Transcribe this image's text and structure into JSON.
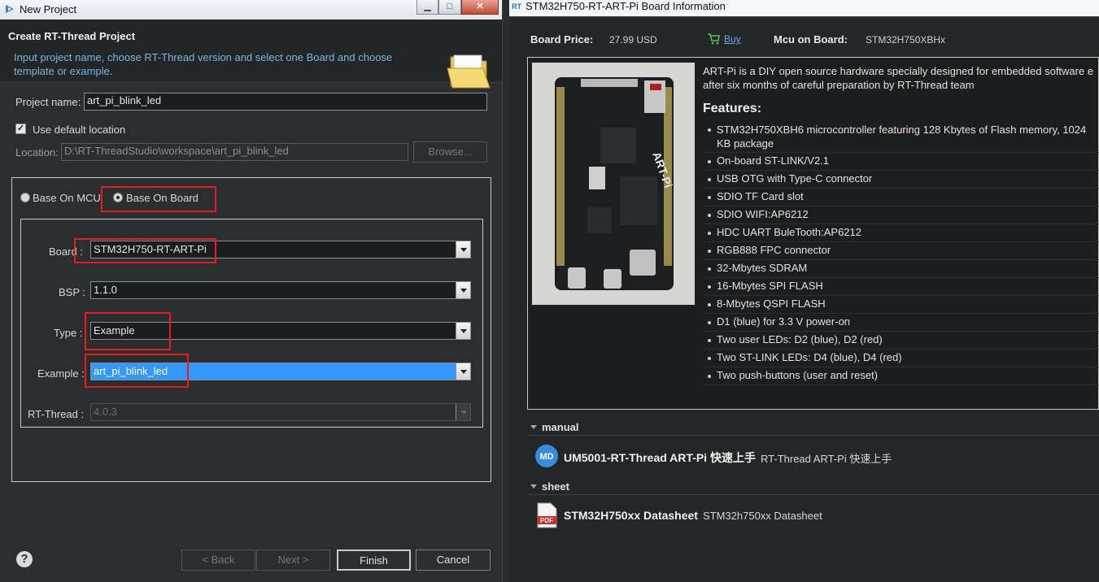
{
  "dialog": {
    "title": "New Project",
    "header_title": "Create RT-Thread Project",
    "header_desc": "Input project name, choose RT-Thread version and select one Board and choose template or example.",
    "project_name_label": "Project name:",
    "project_name_value": "art_pi_blink_led",
    "use_default_label": "Use default location",
    "use_default_checked": true,
    "location_label": "Location:",
    "location_value": "D:\\RT-ThreadStudio\\workspace\\art_pi_blink_led",
    "browse_label": "Browse...",
    "radio_mcu_label": "Base On MCU",
    "radio_board_label": "Base On Board",
    "board_label": "Board :",
    "board_value": "STM32H750-RT-ART-Pi",
    "bsp_label": "BSP :",
    "bsp_value": "1.1.0",
    "type_label": "Type :",
    "type_value": "Example",
    "example_label": "Example :",
    "example_value": "art_pi_blink_led",
    "rtthread_label": "RT-Thread :",
    "rtthread_value": "4.0.3",
    "back_label": "< Back",
    "next_label": "Next >",
    "finish_label": "Finish",
    "cancel_label": "Cancel",
    "help_glyph": "?"
  },
  "window_buttons": {
    "minimize": "▁",
    "maximize": "□",
    "close": "✕"
  },
  "board_info": {
    "title": "STM32H750-RT-ART-Pi Board Information",
    "price_label": "Board Price:",
    "price_value": "27.99 USD",
    "buy_label": "Buy",
    "mcu_label": "Mcu on Board:",
    "mcu_value": "STM32H750XBHx",
    "desc_line1": "ART-Pi is a DIY open source hardware specially designed for embedded software e",
    "desc_line2": "after six months of careful preparation by RT-Thread team",
    "board_silkscreen": "ART-Pi",
    "features_title": "Features:",
    "features": [
      "STM32H750XBH6 microcontroller featuring 128 Kbytes of Flash memory, 1024 KB package",
      "On-board ST-LINK/V2.1",
      "USB OTG with Type-C connector",
      "SDIO TF Card slot",
      "SDIO WIFI:AP6212",
      "HDC UART BuleTooth:AP6212",
      "RGB888 FPC connector",
      "32-Mbytes SDRAM",
      "16-Mbytes SPI FLASH",
      "8-Mbytes QSPI FLASH",
      "D1 (blue) for 3.3 V power-on",
      "Two user LEDs: D2 (blue), D2 (red)",
      "Two ST-LINK LEDs: D4 (blue), D4 (red)",
      "Two push-buttons (user and reset)"
    ],
    "manual_section": "manual",
    "manual_icon_text": "MD",
    "manual_name": "UM5001-RT-Thread ART-Pi 快速上手",
    "manual_desc": "RT-Thread ART-Pi 快速上手",
    "sheet_section": "sheet",
    "sheet_icon_text": "PDF",
    "sheet_name": "STM32H750xx Datasheet",
    "sheet_desc": "STM32h750xx Datasheet"
  },
  "colors": {
    "highlight": "#e02020",
    "selection": "#3399ff",
    "link": "#6aa6e8",
    "desc": "#7ab6dc"
  }
}
